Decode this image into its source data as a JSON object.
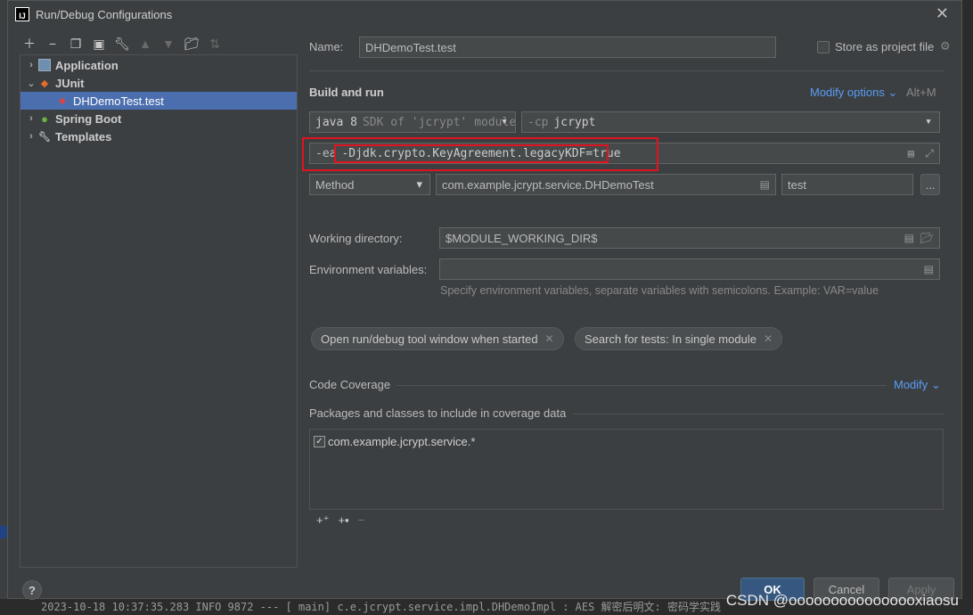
{
  "window": {
    "title": "Run/Debug Configurations"
  },
  "tree": {
    "items": [
      {
        "label": "Application",
        "indent": 0,
        "expanded": false
      },
      {
        "label": "JUnit",
        "indent": 0,
        "expanded": true
      },
      {
        "label": "DHDemoTest.test",
        "indent": 1,
        "selected": true
      },
      {
        "label": "Spring Boot",
        "indent": 0,
        "expanded": false
      },
      {
        "label": "Templates",
        "indent": 0,
        "expanded": false
      }
    ]
  },
  "form": {
    "name_label": "Name:",
    "name_value": "DHDemoTest.test",
    "store_label": "Store as project file",
    "build_run": "Build and run",
    "modify_options": "Modify options",
    "modify_shortcut": "Alt+M",
    "jre": "java 8",
    "jre_hint": "SDK of 'jcrypt' module",
    "cp_prefix": "-cp",
    "cp_value": "jcrypt",
    "vm_prefix": "-ea",
    "vm_value": "-Djdk.crypto.KeyAgreement.legacyKDF=true",
    "test_kind": "Method",
    "class_value": "com.example.jcrypt.service.DHDemoTest",
    "method_value": "test",
    "more_button": "...",
    "workdir_label": "Working directory:",
    "workdir_value": "$MODULE_WORKING_DIR$",
    "env_label": "Environment variables:",
    "env_value": "",
    "env_hint": "Specify environment variables, separate variables with semicolons. Example: VAR=value",
    "chip1": "Open run/debug tool window when started",
    "chip2": "Search for tests: In single module",
    "coverage_label": "Code Coverage",
    "coverage_modify": "Modify",
    "packages_label": "Packages and classes to include in coverage data",
    "package_item": "com.example.jcrypt.service.*"
  },
  "buttons": {
    "ok": "OK",
    "cancel": "Cancel",
    "apply": "Apply",
    "help": "?"
  },
  "background": {
    "console_line": "2023-10-18 10:37:35.283  INFO 9872 --- [           main] c.e.jcrypt.service.impl.DHDemoImpl       : AES 解密后明文: 密码学实践"
  },
  "watermark": "CSDN @oooooooooooooooxiaosu"
}
